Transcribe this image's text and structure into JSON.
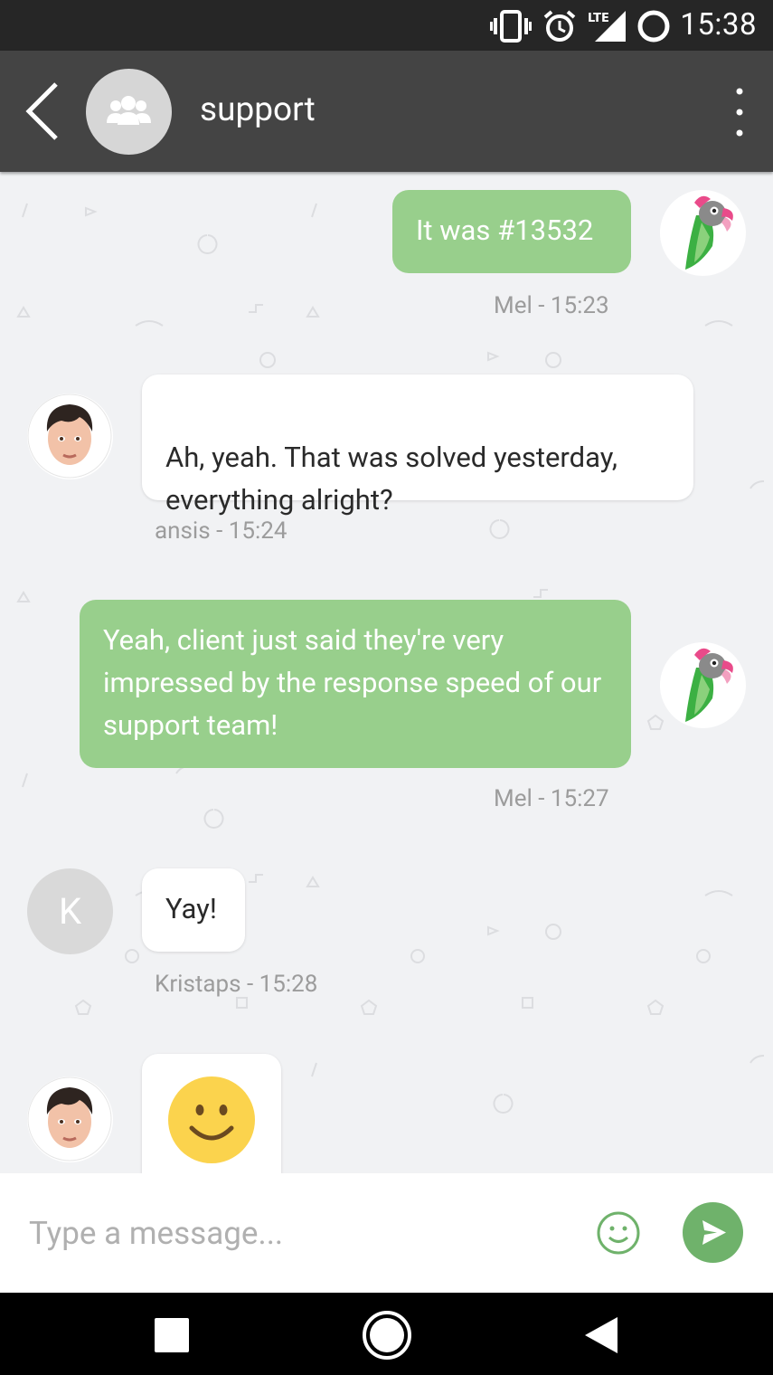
{
  "status_bar": {
    "time": "15:38",
    "network": "LTE"
  },
  "app_bar": {
    "title": "support"
  },
  "messages": [
    {
      "text": "It was #13532",
      "meta": "Mel - 15:23"
    },
    {
      "text": "Ah, yeah. That was solved yesterday,\neverything alright?",
      "meta": "ansis - 15:24"
    },
    {
      "text": "Yeah, client just said they're very impressed by the response speed of our support team!",
      "meta": "Mel - 15:27"
    },
    {
      "text": "Yay!",
      "meta": "Kristaps - 15:28",
      "avatar_initial": "K"
    },
    {
      "content": "smiley-emoji"
    }
  ],
  "compose": {
    "placeholder": "Type a message..."
  },
  "colors": {
    "outgoing_bubble": "#98cf8c",
    "send_button": "#6fb26b",
    "app_bar": "#444444"
  }
}
